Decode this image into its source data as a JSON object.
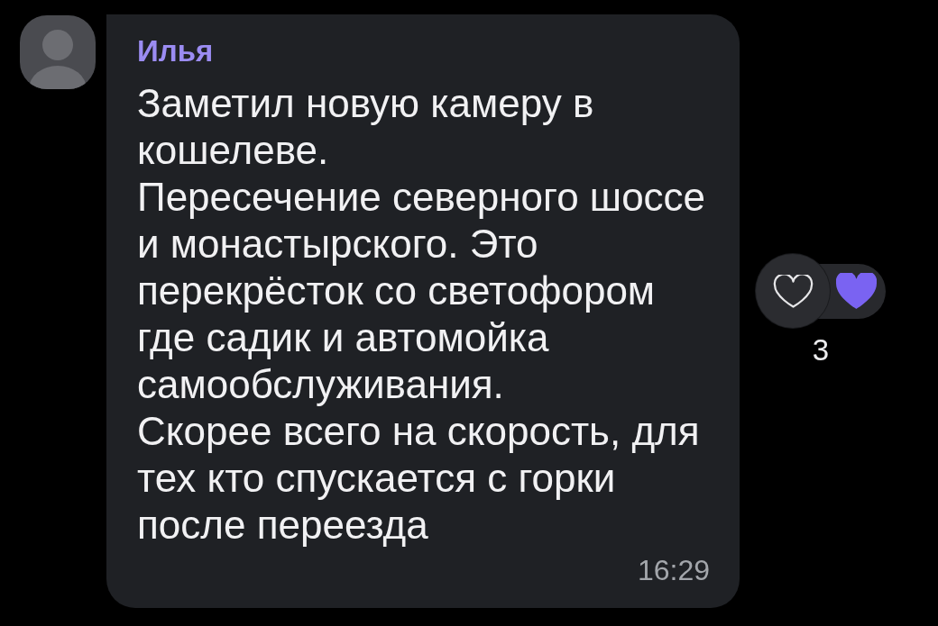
{
  "message": {
    "sender": {
      "name": "Илья"
    },
    "paragraphs": [
      "Заметил новую камеру в кошелеве.",
      "Пересечение северного шоссе и монастырского. Это перекрёсток со светофором где садик и автомойка самообслуживания.",
      "Скорее всего на скорость, для тех кто спускается с горки после переезда"
    ],
    "time": "16:29"
  },
  "reactions": [
    {
      "count": "3"
    }
  ]
}
